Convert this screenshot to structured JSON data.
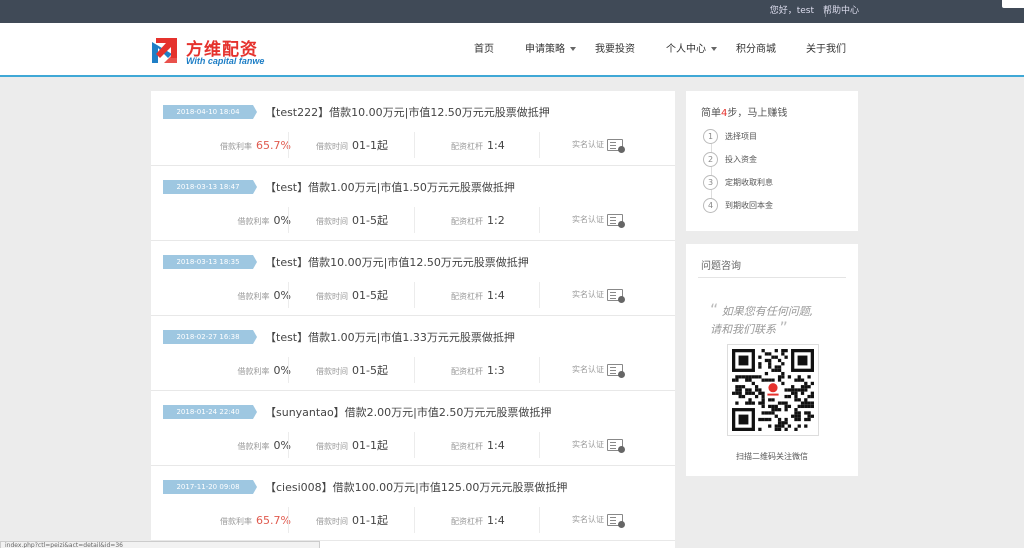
{
  "topbar": {
    "greeting": "您好，test",
    "help": "帮助中心"
  },
  "logo": {
    "cn": "方维配资",
    "en": "With capital fanwe"
  },
  "nav": [
    {
      "label": "首页",
      "caret": false
    },
    {
      "label": "申请策略",
      "caret": true
    },
    {
      "label": "我要投资",
      "caret": false
    },
    {
      "label": "个人中心",
      "caret": true
    },
    {
      "label": "积分商城",
      "caret": false
    },
    {
      "label": "关于我们",
      "caret": false
    }
  ],
  "listing": {
    "rate_label": "借款利率",
    "time_label": "借款时间",
    "lever_label": "配资杠杆",
    "auth_label": "实名认证",
    "items": [
      {
        "date": "2018-04-10 18:04",
        "title": "【test222】借款10.00万元|市值12.50万元元股票做抵押",
        "rate": "65.7%",
        "time": "01-1起",
        "lever": "1:4"
      },
      {
        "date": "2018-03-13 18:47",
        "title": "【test】借款1.00万元|市值1.50万元元股票做抵押",
        "rate": "0%",
        "time": "01-5起",
        "lever": "1:2"
      },
      {
        "date": "2018-03-13 18:35",
        "title": "【test】借款10.00万元|市值12.50万元元股票做抵押",
        "rate": "0%",
        "time": "01-5起",
        "lever": "1:4"
      },
      {
        "date": "2018-02-27 16:38",
        "title": "【test】借款1.00万元|市值1.33万元元股票做抵押",
        "rate": "0%",
        "time": "01-5起",
        "lever": "1:3"
      },
      {
        "date": "2018-01-24 22:40",
        "title": "【sunyantao】借款2.00万元|市值2.50万元元股票做抵押",
        "rate": "0%",
        "time": "01-1起",
        "lever": "1:4"
      },
      {
        "date": "2017-11-20 09:08",
        "title": "【ciesi008】借款100.00万元|市值125.00万元元股票做抵押",
        "rate": "65.7%",
        "time": "01-1起",
        "lever": "1:4"
      }
    ]
  },
  "steps": {
    "head_pre": "简单",
    "head_num": "4",
    "head_post": "步，马上赚钱",
    "items": [
      "选择项目",
      "投入资金",
      "定期收取利息",
      "到期收回本金"
    ]
  },
  "consult": {
    "title": "问题咨询",
    "quote_line1": "如果您有任何问题,",
    "quote_line2": "请和我们联系",
    "caption": "扫描二维码关注微信"
  },
  "statusbar": "index.php?ctl=peizi&act=detail&id=36",
  "colors": {
    "accent": "#3fa8d6",
    "brand_red": "#e5322d",
    "date_tag": "#9ec7e1",
    "topbar": "#404a57"
  }
}
